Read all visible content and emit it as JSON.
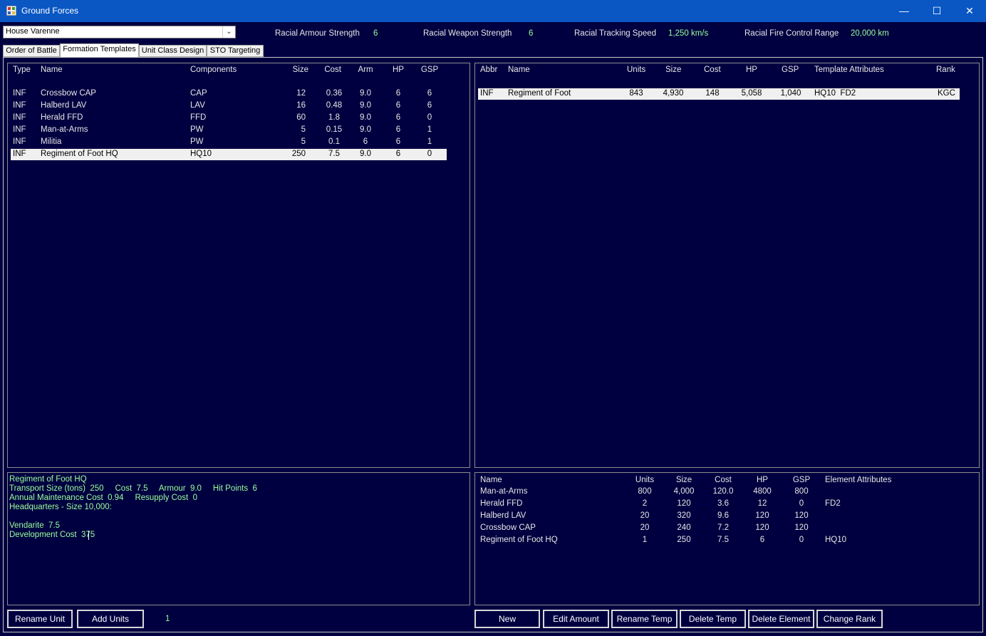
{
  "window": {
    "title": "Ground Forces"
  },
  "race_select": {
    "value": "House Varenne"
  },
  "racial_stats": [
    {
      "label": "Racial Armour Strength",
      "value": "6"
    },
    {
      "label": "Racial Weapon Strength",
      "value": "6"
    },
    {
      "label": "Racial Tracking Speed",
      "value": "1,250 km/s"
    },
    {
      "label": "Racial Fire Control Range",
      "value": "20,000 km"
    }
  ],
  "tabs": [
    {
      "label": "Order of Battle"
    },
    {
      "label": "Formation Templates"
    },
    {
      "label": "Unit Class Design"
    },
    {
      "label": "STO Targeting"
    }
  ],
  "unit_classes": {
    "headers": {
      "type": "Type",
      "name": "Name",
      "components": "Components",
      "size": "Size",
      "cost": "Cost",
      "arm": "Arm",
      "hp": "HP",
      "gsp": "GSP"
    },
    "rows": [
      {
        "type": "INF",
        "name": "Crossbow CAP",
        "components": "CAP",
        "size": "12",
        "cost": "0.36",
        "arm": "9.0",
        "hp": "6",
        "gsp": "6"
      },
      {
        "type": "INF",
        "name": "Halberd LAV",
        "components": "LAV",
        "size": "16",
        "cost": "0.48",
        "arm": "9.0",
        "hp": "6",
        "gsp": "6"
      },
      {
        "type": "INF",
        "name": "Herald FFD",
        "components": "FFD",
        "size": "60",
        "cost": "1.8",
        "arm": "9.0",
        "hp": "6",
        "gsp": "0"
      },
      {
        "type": "INF",
        "name": "Man-at-Arms",
        "components": "PW",
        "size": "5",
        "cost": "0.15",
        "arm": "9.0",
        "hp": "6",
        "gsp": "1"
      },
      {
        "type": "INF",
        "name": "Militia",
        "components": "PW",
        "size": "5",
        "cost": "0.1",
        "arm": "6",
        "hp": "6",
        "gsp": "1"
      },
      {
        "type": "INF",
        "name": "Regiment of Foot HQ",
        "components": "HQ10",
        "size": "250",
        "cost": "7.5",
        "arm": "9.0",
        "hp": "6",
        "gsp": "0"
      }
    ]
  },
  "templates": {
    "headers": {
      "abbr": "Abbr",
      "name": "Name",
      "units": "Units",
      "size": "Size",
      "cost": "Cost",
      "hp": "HP",
      "gsp": "GSP",
      "attrs": "Template Attributes",
      "rank": "Rank"
    },
    "rows": [
      {
        "abbr": "INF",
        "name": "Regiment of Foot",
        "units": "843",
        "size": "4,930",
        "cost": "148",
        "hp": "5,058",
        "gsp": "1,040",
        "attrs": "HQ10  FD2",
        "rank": "KGC"
      }
    ]
  },
  "detail": {
    "lines": [
      "Regiment of Foot HQ",
      "Transport Size (tons)  250     Cost  7.5     Armour  9.0     Hit Points  6",
      "Annual Maintenance Cost  0.94     Resupply Cost  0",
      "Headquarters - Size 10,000:",
      "",
      "Vendarite  7.5",
      "Development Cost  375"
    ]
  },
  "elements": {
    "headers": {
      "name": "Name",
      "units": "Units",
      "size": "Size",
      "cost": "Cost",
      "hp": "HP",
      "gsp": "GSP",
      "attrs": "Element Attributes"
    },
    "rows": [
      {
        "name": "Man-at-Arms",
        "units": "800",
        "size": "4,000",
        "cost": "120.0",
        "hp": "4800",
        "gsp": "800",
        "attrs": ""
      },
      {
        "name": "Herald FFD",
        "units": "2",
        "size": "120",
        "cost": "3.6",
        "hp": "12",
        "gsp": "0",
        "attrs": "FD2"
      },
      {
        "name": "Halberd LAV",
        "units": "20",
        "size": "320",
        "cost": "9.6",
        "hp": "120",
        "gsp": "120",
        "attrs": ""
      },
      {
        "name": "Crossbow CAP",
        "units": "20",
        "size": "240",
        "cost": "7.2",
        "hp": "120",
        "gsp": "120",
        "attrs": ""
      },
      {
        "name": "Regiment of Foot HQ",
        "units": "1",
        "size": "250",
        "cost": "7.5",
        "hp": "6",
        "gsp": "0",
        "attrs": "HQ10"
      }
    ]
  },
  "buttons": {
    "rename_unit": "Rename Unit",
    "add_units": "Add Units",
    "unit_count": "1",
    "new": "New",
    "edit_amount": "Edit Amount",
    "rename_temp": "Rename Temp",
    "delete_temp": "Delete Temp",
    "delete_element": "Delete Element",
    "change_rank": "Change Rank"
  }
}
